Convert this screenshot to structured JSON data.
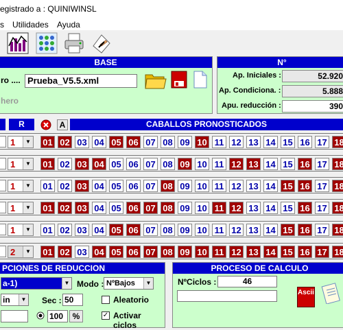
{
  "window": {
    "title": "egistrado a : QUINIWINSL"
  },
  "menu": {
    "item1": "s",
    "item2": "Utilidades",
    "item3": "Ayuda"
  },
  "toolbar": {
    "icons": [
      "chart-icon",
      "grid-dots-icon",
      "printer-icon",
      "hand-write-icon"
    ]
  },
  "base": {
    "title": "BASE",
    "file_label": "ro ....",
    "file_value": "Prueba_V5.5.xml",
    "sub_label": "hero"
  },
  "stats": {
    "title": "N°",
    "rows": [
      {
        "label": "Ap. Iniciales :",
        "value": "52.920"
      },
      {
        "label": "Ap. Condiciona. :",
        "value": "5.888"
      },
      {
        "label": "Apu. reducción :",
        "value": "390"
      }
    ]
  },
  "grid": {
    "col_r": "R",
    "col_a": "A",
    "title": "CABALLOS PRONOSTICADOS",
    "numbers": [
      "01",
      "02",
      "03",
      "04",
      "05",
      "06",
      "07",
      "08",
      "09",
      "10",
      "11",
      "12",
      "13",
      "14",
      "15",
      "16",
      "17",
      "18"
    ],
    "rows": [
      {
        "r": "1",
        "grey": false,
        "on": [
          1,
          2,
          5,
          6,
          10,
          18
        ]
      },
      {
        "r": "1",
        "grey": false,
        "on": [
          1,
          3,
          4,
          9,
          12,
          13,
          16,
          18
        ]
      },
      {
        "r": "1",
        "grey": false,
        "on": [
          3,
          8,
          15,
          16,
          18
        ]
      },
      {
        "r": "1",
        "grey": false,
        "on": [
          1,
          2,
          3,
          6,
          7,
          8,
          11,
          12,
          16,
          18
        ]
      },
      {
        "r": "1",
        "grey": false,
        "on": [
          5,
          6,
          15,
          16,
          18
        ]
      },
      {
        "r": "2",
        "grey": true,
        "on": [
          1,
          2,
          4,
          5,
          6,
          7,
          8,
          9,
          10,
          11,
          12,
          13,
          14,
          15,
          16,
          17,
          18
        ]
      }
    ]
  },
  "reduction": {
    "title": "PCIONES DE REDUCCION",
    "combo1": "a-1)",
    "modo_label": "Modo :",
    "modo_value": "NºBajos",
    "combo2": "in",
    "sec_label": "Sec :",
    "sec_value": "50",
    "aleatorio_label": "Aleatorio",
    "percent_value": "100",
    "percent_btn": "%",
    "activar_label": "Activar ciclos"
  },
  "proceso": {
    "title": "PROCESO DE CALCULO",
    "ciclos_label": "NºCiclos :",
    "ciclos_value": "46",
    "ascii_label": "Ascii"
  },
  "colors": {
    "accent": "#0000cc",
    "panel": "#ccffcc",
    "selected": "#a00000"
  }
}
